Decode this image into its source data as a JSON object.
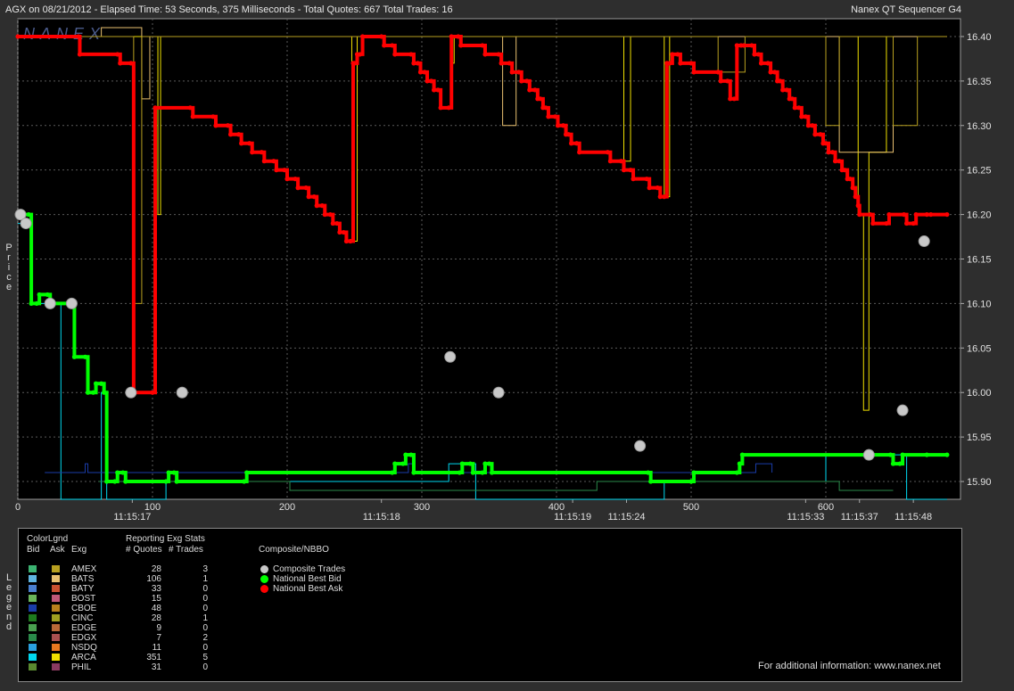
{
  "header": {
    "left_text": "AGX on 08/21/2012  -  Elapsed Time: 53 Seconds, 375 Milliseconds  -  Total Quotes: 667  Total Trades: 16",
    "right_text": "Nanex QT Sequencer G4",
    "watermark": "NANEX"
  },
  "side_labels": {
    "y_axis": "Price",
    "legend": "Legend"
  },
  "colors": {
    "bid_line": "#00ff00",
    "ask_line": "#ff0000",
    "trade_marker": "#c8c8c8",
    "background": "#000000",
    "grid": "#5a5a5a"
  },
  "chart_data": {
    "type": "line",
    "title": "",
    "xlim": [
      0,
      667
    ],
    "ylim": [
      15.88,
      16.42
    ],
    "grid": true,
    "x_ticks": [
      "0",
      "100",
      "200",
      "300",
      "400",
      "500",
      "600"
    ],
    "time_labels": [
      {
        "x": 85,
        "label": "11:15:17"
      },
      {
        "x": 270,
        "label": "11:15:18"
      },
      {
        "x": 412,
        "label": "11:15:19"
      },
      {
        "x": 452,
        "label": "11:15:24"
      },
      {
        "x": 585,
        "label": "11:15:33"
      },
      {
        "x": 625,
        "label": "11:15:37"
      },
      {
        "x": 665,
        "label": "11:15:48"
      }
    ],
    "y_ticks": [
      "16.40",
      "16.35",
      "16.30",
      "16.25",
      "16.20",
      "16.15",
      "16.10",
      "16.05",
      "16.00",
      "15.95",
      "15.90"
    ],
    "series": [
      {
        "name": "National Best Ask",
        "color": "#ff0000",
        "points": [
          [
            0,
            16.4
          ],
          [
            45,
            16.4
          ],
          [
            46,
            16.38
          ],
          [
            74,
            16.38
          ],
          [
            76,
            16.37
          ],
          [
            84,
            16.37
          ],
          [
            86,
            16.0
          ],
          [
            100,
            16.0
          ],
          [
            102,
            16.32
          ],
          [
            128,
            16.32
          ],
          [
            130,
            16.31
          ],
          [
            145,
            16.31
          ],
          [
            147,
            16.3
          ],
          [
            156,
            16.3
          ],
          [
            158,
            16.29
          ],
          [
            164,
            16.29
          ],
          [
            166,
            16.28
          ],
          [
            172,
            16.28
          ],
          [
            174,
            16.27
          ],
          [
            181,
            16.27
          ],
          [
            183,
            16.26
          ],
          [
            190,
            16.26
          ],
          [
            192,
            16.25
          ],
          [
            198,
            16.25
          ],
          [
            200,
            16.24
          ],
          [
            206,
            16.24
          ],
          [
            208,
            16.23
          ],
          [
            214,
            16.23
          ],
          [
            216,
            16.22
          ],
          [
            220,
            16.22
          ],
          [
            222,
            16.21
          ],
          [
            226,
            16.21
          ],
          [
            228,
            16.2
          ],
          [
            232,
            16.2
          ],
          [
            234,
            16.19
          ],
          [
            237,
            16.19
          ],
          [
            239,
            16.18
          ],
          [
            242,
            16.18
          ],
          [
            244,
            16.17
          ],
          [
            247,
            16.17
          ],
          [
            249,
            16.37
          ],
          [
            250,
            16.37
          ],
          [
            252,
            16.38
          ],
          [
            254,
            16.38
          ],
          [
            256,
            16.4
          ],
          [
            270,
            16.4
          ],
          [
            272,
            16.39
          ],
          [
            278,
            16.39
          ],
          [
            280,
            16.38
          ],
          [
            292,
            16.38
          ],
          [
            294,
            16.37
          ],
          [
            297,
            16.37
          ],
          [
            299,
            16.36
          ],
          [
            302,
            16.36
          ],
          [
            304,
            16.35
          ],
          [
            307,
            16.35
          ],
          [
            309,
            16.34
          ],
          [
            312,
            16.34
          ],
          [
            314,
            16.32
          ],
          [
            320,
            16.32
          ],
          [
            322,
            16.4
          ],
          [
            327,
            16.4
          ],
          [
            329,
            16.39
          ],
          [
            345,
            16.39
          ],
          [
            347,
            16.38
          ],
          [
            357,
            16.38
          ],
          [
            359,
            16.37
          ],
          [
            365,
            16.37
          ],
          [
            367,
            16.36
          ],
          [
            372,
            16.36
          ],
          [
            374,
            16.35
          ],
          [
            378,
            16.35
          ],
          [
            380,
            16.34
          ],
          [
            384,
            16.34
          ],
          [
            386,
            16.33
          ],
          [
            388,
            16.33
          ],
          [
            390,
            16.32
          ],
          [
            392,
            16.32
          ],
          [
            394,
            16.31
          ],
          [
            399,
            16.31
          ],
          [
            401,
            16.3
          ],
          [
            405,
            16.3
          ],
          [
            407,
            16.29
          ],
          [
            409,
            16.29
          ],
          [
            411,
            16.28
          ],
          [
            415,
            16.28
          ],
          [
            417,
            16.27
          ],
          [
            438,
            16.27
          ],
          [
            440,
            16.26
          ],
          [
            448,
            16.26
          ],
          [
            450,
            16.25
          ],
          [
            455,
            16.25
          ],
          [
            457,
            16.24
          ],
          [
            467,
            16.24
          ],
          [
            469,
            16.23
          ],
          [
            475,
            16.23
          ],
          [
            477,
            16.22
          ],
          [
            480,
            16.22
          ],
          [
            482,
            16.37
          ],
          [
            484,
            16.37
          ],
          [
            486,
            16.38
          ],
          [
            490,
            16.38
          ],
          [
            492,
            16.37
          ],
          [
            500,
            16.37
          ],
          [
            502,
            16.36
          ],
          [
            520,
            16.36
          ],
          [
            522,
            16.35
          ],
          [
            527,
            16.35
          ],
          [
            529,
            16.33
          ],
          [
            532,
            16.33
          ],
          [
            534,
            16.39
          ],
          [
            537,
            16.39
          ],
          [
            539,
            16.39
          ],
          [
            545,
            16.39
          ],
          [
            547,
            16.38
          ],
          [
            550,
            16.38
          ],
          [
            552,
            16.37
          ],
          [
            557,
            16.37
          ],
          [
            559,
            16.36
          ],
          [
            562,
            16.36
          ],
          [
            564,
            16.35
          ],
          [
            566,
            16.35
          ],
          [
            568,
            16.34
          ],
          [
            571,
            16.34
          ],
          [
            573,
            16.33
          ],
          [
            575,
            16.33
          ],
          [
            577,
            16.32
          ],
          [
            580,
            16.32
          ],
          [
            582,
            16.31
          ],
          [
            585,
            16.31
          ],
          [
            587,
            16.3
          ],
          [
            590,
            16.3
          ],
          [
            592,
            16.29
          ],
          [
            596,
            16.29
          ],
          [
            598,
            16.28
          ],
          [
            600,
            16.28
          ],
          [
            602,
            16.27
          ],
          [
            605,
            16.27
          ],
          [
            607,
            16.26
          ],
          [
            610,
            16.26
          ],
          [
            612,
            16.25
          ],
          [
            614,
            16.25
          ],
          [
            616,
            16.24
          ],
          [
            618,
            16.24
          ],
          [
            620,
            16.23
          ],
          [
            622,
            16.22
          ],
          [
            624,
            16.21
          ],
          [
            625,
            16.2
          ],
          [
            633,
            16.2
          ],
          [
            635,
            16.19
          ],
          [
            645,
            16.19
          ],
          [
            647,
            16.2
          ],
          [
            658,
            16.2
          ],
          [
            660,
            16.19
          ],
          [
            665,
            16.19
          ],
          [
            667,
            16.2
          ],
          [
            675,
            16.2
          ],
          [
            678,
            16.2
          ],
          [
            690,
            16.2
          ]
        ]
      },
      {
        "name": "National Best Bid",
        "color": "#00ff00",
        "points": [
          [
            0,
            16.2
          ],
          [
            8,
            16.2
          ],
          [
            10,
            16.1
          ],
          [
            14,
            16.1
          ],
          [
            16,
            16.11
          ],
          [
            22,
            16.11
          ],
          [
            24,
            16.1
          ],
          [
            40,
            16.1
          ],
          [
            42,
            16.04
          ],
          [
            50,
            16.04
          ],
          [
            52,
            16.0
          ],
          [
            56,
            16.0
          ],
          [
            58,
            16.01
          ],
          [
            62,
            16.01
          ],
          [
            64,
            16.0
          ],
          [
            66,
            15.9
          ],
          [
            72,
            15.9
          ],
          [
            74,
            15.91
          ],
          [
            78,
            15.91
          ],
          [
            80,
            15.9
          ],
          [
            110,
            15.9
          ],
          [
            112,
            15.91
          ],
          [
            116,
            15.91
          ],
          [
            118,
            15.9
          ],
          [
            168,
            15.9
          ],
          [
            170,
            15.91
          ],
          [
            278,
            15.91
          ],
          [
            280,
            15.92
          ],
          [
            286,
            15.92
          ],
          [
            288,
            15.93
          ],
          [
            292,
            15.93
          ],
          [
            294,
            15.91
          ],
          [
            328,
            15.91
          ],
          [
            330,
            15.92
          ],
          [
            336,
            15.92
          ],
          [
            338,
            15.91
          ],
          [
            345,
            15.91
          ],
          [
            347,
            15.92
          ],
          [
            350,
            15.92
          ],
          [
            352,
            15.91
          ],
          [
            468,
            15.91
          ],
          [
            470,
            15.9
          ],
          [
            500,
            15.9
          ],
          [
            502,
            15.91
          ],
          [
            534,
            15.91
          ],
          [
            536,
            15.92
          ],
          [
            538,
            15.93
          ],
          [
            648,
            15.93
          ],
          [
            650,
            15.92
          ],
          [
            655,
            15.92
          ],
          [
            657,
            15.93
          ],
          [
            675,
            15.93
          ],
          [
            690,
            15.93
          ]
        ]
      }
    ],
    "trades": [
      [
        2,
        16.2
      ],
      [
        6,
        16.19
      ],
      [
        24,
        16.1
      ],
      [
        40,
        16.1
      ],
      [
        84,
        16.0
      ],
      [
        122,
        16.0
      ],
      [
        321,
        16.04
      ],
      [
        357,
        16.0
      ],
      [
        462,
        15.94
      ],
      [
        632,
        15.93
      ],
      [
        657,
        15.98
      ],
      [
        673,
        16.17
      ]
    ]
  },
  "legend": {
    "headers": {
      "color_lgnd": "ColorLgnd",
      "bid": "Bid",
      "ask": "Ask",
      "exg": "Exg",
      "stats_title": "Reporting Exg Stats",
      "quotes": "# Quotes",
      "trades": "# Trades",
      "composite_title": "Composite/NBBO"
    },
    "exchanges": [
      {
        "name": "AMEX",
        "quotes": "28",
        "trades": "3",
        "bid_color": "#3cb371",
        "ask_color": "#b8a020"
      },
      {
        "name": "BATS",
        "quotes": "106",
        "trades": "1",
        "bid_color": "#5fb4e0",
        "ask_color": "#e8c070"
      },
      {
        "name": "BATY",
        "quotes": "33",
        "trades": "0",
        "bid_color": "#4a7fd0",
        "ask_color": "#c85030"
      },
      {
        "name": "BOST",
        "quotes": "15",
        "trades": "0",
        "bid_color": "#6ab45a",
        "ask_color": "#c05878"
      },
      {
        "name": "CBOE",
        "quotes": "48",
        "trades": "0",
        "bid_color": "#1a3ca8",
        "ask_color": "#b8801c"
      },
      {
        "name": "CINC",
        "quotes": "28",
        "trades": "1",
        "bid_color": "#1e7a1e",
        "ask_color": "#a0a020"
      },
      {
        "name": "EDGE",
        "quotes": "9",
        "trades": "0",
        "bid_color": "#4aa050",
        "ask_color": "#b86838"
      },
      {
        "name": "EDGX",
        "quotes": "7",
        "trades": "2",
        "bid_color": "#2a8a4a",
        "ask_color": "#a85050"
      },
      {
        "name": "NSDQ",
        "quotes": "11",
        "trades": "0",
        "bid_color": "#2aa0e0",
        "ask_color": "#e87820"
      },
      {
        "name": "ARCA",
        "quotes": "351",
        "trades": "5",
        "bid_color": "#00d8f0",
        "ask_color": "#f0e000"
      },
      {
        "name": "PHIL",
        "quotes": "31",
        "trades": "0",
        "bid_color": "#5a8a30",
        "ask_color": "#8a3a60"
      }
    ],
    "composite": [
      {
        "label": "Composite Trades",
        "color": "#c8c8c8"
      },
      {
        "label": "National Best Bid",
        "color": "#00ff00"
      },
      {
        "label": "National Best Ask",
        "color": "#ff0000"
      }
    ],
    "footer": "For additional information: www.nanex.net"
  }
}
